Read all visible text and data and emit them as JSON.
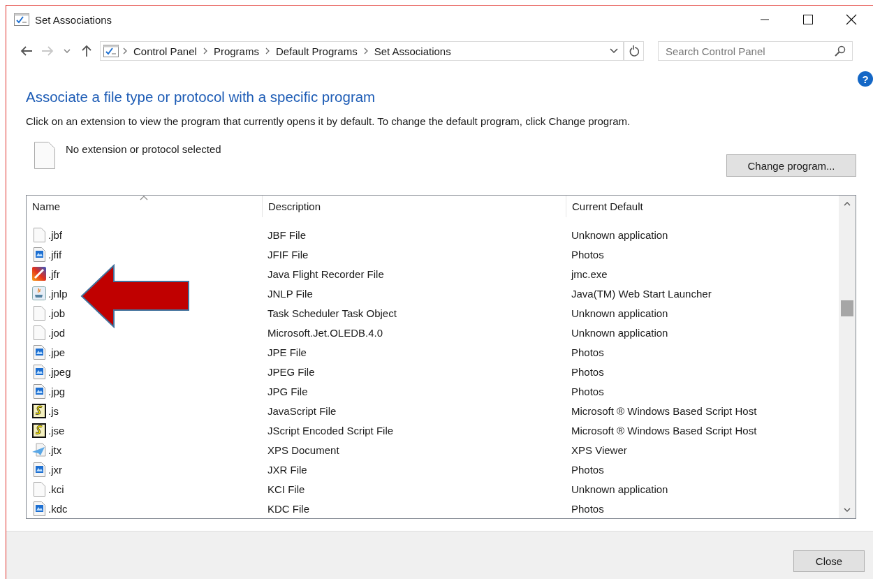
{
  "window": {
    "title": "Set Associations"
  },
  "address_bar": {
    "breadcrumbs": [
      "Control Panel",
      "Programs",
      "Default Programs",
      "Set Associations"
    ]
  },
  "search": {
    "placeholder": "Search Control Panel"
  },
  "help_button": "?",
  "heading": "Associate a file type or protocol with a specific program",
  "description": "Click on an extension to view the program that currently opens it by default. To change the default program, click Change program.",
  "selection": {
    "text": "No extension or protocol selected"
  },
  "change_button": "Change program...",
  "list": {
    "columns": [
      "Name",
      "Description",
      "Current Default"
    ],
    "rows": [
      {
        "name": ".jbf",
        "description": "JBF File",
        "default": "Unknown application",
        "kind": "blank"
      },
      {
        "name": ".jfif",
        "description": "JFIF File",
        "default": "Photos",
        "kind": "image"
      },
      {
        "name": ".jfr",
        "description": "Java Flight Recorder File",
        "default": "jmc.exe",
        "kind": "recorder"
      },
      {
        "name": ".jnlp",
        "description": "JNLP File",
        "default": "Java(TM) Web Start Launcher",
        "kind": "java"
      },
      {
        "name": ".job",
        "description": "Task Scheduler Task Object",
        "default": "Unknown application",
        "kind": "blank"
      },
      {
        "name": ".jod",
        "description": "Microsoft.Jet.OLEDB.4.0",
        "default": "Unknown application",
        "kind": "blank"
      },
      {
        "name": ".jpe",
        "description": "JPE File",
        "default": "Photos",
        "kind": "image"
      },
      {
        "name": ".jpeg",
        "description": "JPEG File",
        "default": "Photos",
        "kind": "image"
      },
      {
        "name": ".jpg",
        "description": "JPG File",
        "default": "Photos",
        "kind": "image"
      },
      {
        "name": ".js",
        "description": "JavaScript File",
        "default": "Microsoft ® Windows Based Script Host",
        "kind": "script"
      },
      {
        "name": ".jse",
        "description": "JScript Encoded Script File",
        "default": "Microsoft ® Windows Based Script Host",
        "kind": "script"
      },
      {
        "name": ".jtx",
        "description": "XPS Document",
        "default": "XPS Viewer",
        "kind": "xps"
      },
      {
        "name": ".jxr",
        "description": "JXR File",
        "default": "Photos",
        "kind": "image"
      },
      {
        "name": ".kci",
        "description": "KCI File",
        "default": "Unknown application",
        "kind": "blank"
      },
      {
        "name": ".kdc",
        "description": "KDC File",
        "default": "Photos",
        "kind": "image"
      }
    ]
  },
  "close_button": "Close"
}
